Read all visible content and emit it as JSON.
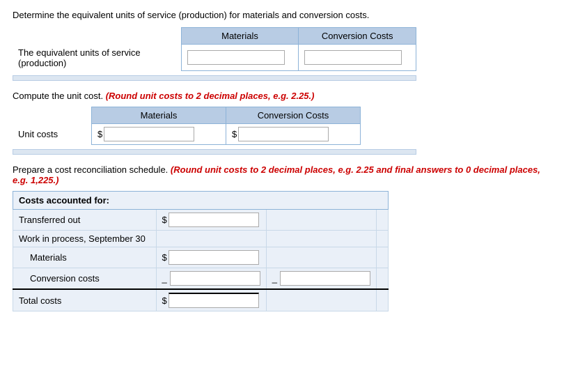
{
  "intro1": {
    "text": "Determine the equivalent units of service (production) for materials and conversion costs."
  },
  "section1": {
    "col1_header": "Materials",
    "col2_header": "Conversion Costs",
    "row1_label": "The equivalent units of service (production)"
  },
  "section2": {
    "intro_start": "Compute the unit cost. ",
    "intro_italic": "(Round unit costs to 2 decimal places, e.g. 2.25.)",
    "col1_header": "Materials",
    "col2_header": "Conversion Costs",
    "row1_label": "Unit costs",
    "dollar1": "$",
    "dollar2": "$"
  },
  "section3": {
    "intro_start": "Prepare a cost reconciliation schedule. ",
    "intro_italic": "(Round unit costs to 2 decimal places, e.g. 2.25 and final answers to 0 decimal places, e.g. 1,225.)",
    "header": "Costs accounted for:",
    "row1_label": "Transferred out",
    "row1_dollar": "$",
    "row2_label": "Work in process, September 30",
    "row3_label": "Materials",
    "row3_dollar": "$",
    "row4_label": "Conversion costs",
    "row5_label": "Total costs",
    "row5_dollar": "$"
  }
}
